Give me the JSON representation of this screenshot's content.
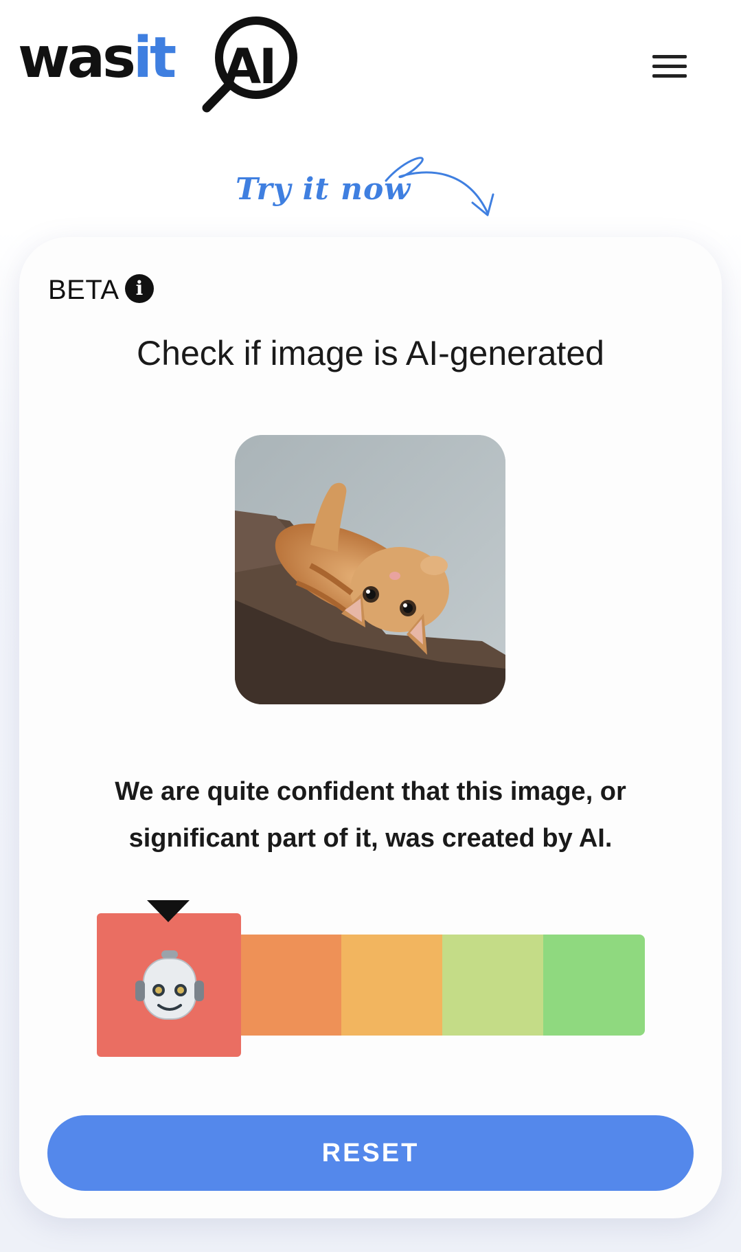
{
  "header": {
    "logo_text_dark": "was",
    "logo_text_blue": "it",
    "logo_text_ai": "AI",
    "menu_icon": "hamburger-menu-icon"
  },
  "banner": {
    "try_it_now": "Try it now",
    "arrow_icon": "curved-arrow-icon"
  },
  "checker": {
    "badge": "BETA",
    "info_icon": "info-icon",
    "title": "Check if image is AI-generated",
    "image_subject": "orange tabby cat lying upside down on cat tree",
    "result_line1": "We are quite confident that this image, or",
    "result_line2": "significant part of it, was created by AI.",
    "meter": {
      "levels": 5,
      "selected_level": 1,
      "colors": [
        "#ea6e62",
        "#ee9157",
        "#f2b55f",
        "#c4dc87",
        "#8fd97f"
      ],
      "indicator_icon": "robot-icon"
    },
    "reset_label": "RESET"
  },
  "colors": {
    "brand_blue": "#3f7fe0",
    "button_blue": "#5488eb"
  }
}
